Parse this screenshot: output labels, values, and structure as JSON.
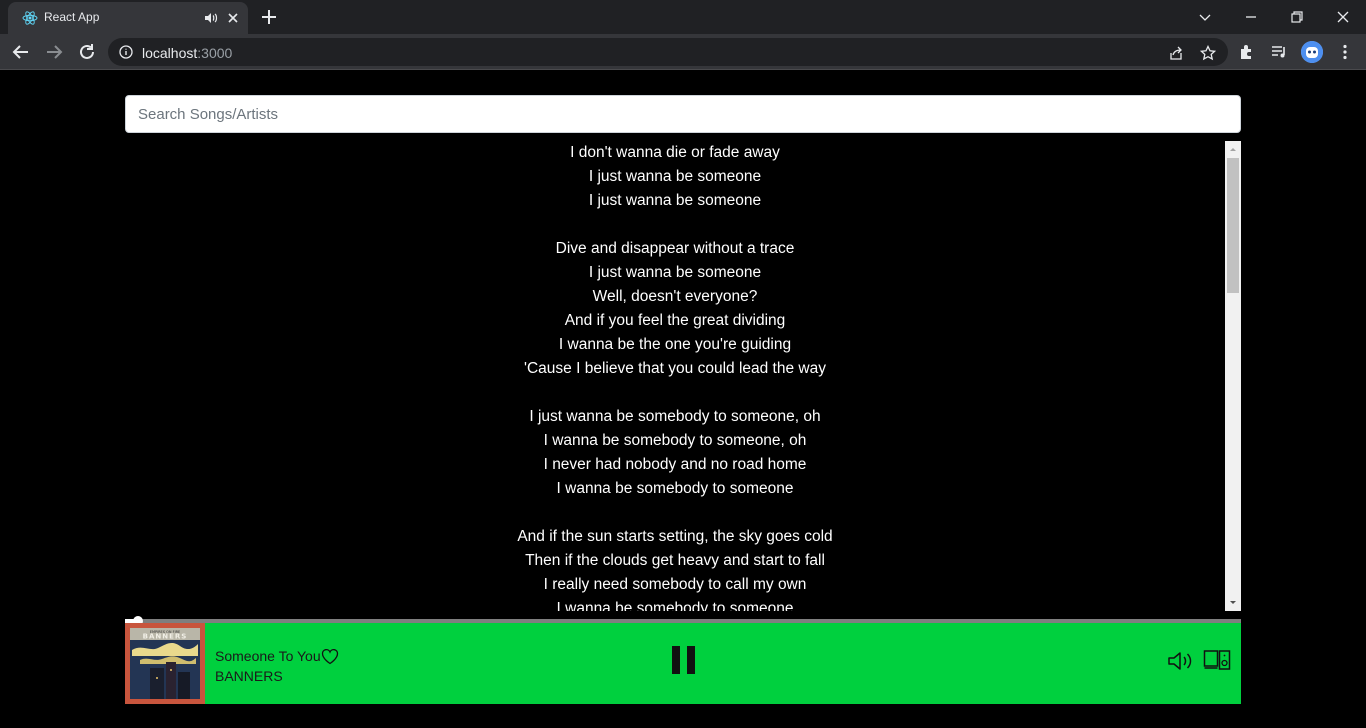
{
  "browser": {
    "tab_title": "React App",
    "url_host": "localhost",
    "url_port": ":3000"
  },
  "search": {
    "placeholder": "Search Songs/Artists",
    "value": ""
  },
  "lyrics": [
    "I don't wanna die or fade away",
    "I just wanna be someone",
    "I just wanna be someone",
    "",
    "Dive and disappear without a trace",
    "I just wanna be someone",
    "Well, doesn't everyone?",
    "And if you feel the great dividing",
    "I wanna be the one you're guiding",
    "'Cause I believe that you could lead the way",
    "",
    "I just wanna be somebody to someone, oh",
    "I wanna be somebody to someone, oh",
    "I never had nobody and no road home",
    "I wanna be somebody to someone",
    "",
    "And if the sun starts setting, the sky goes cold",
    "Then if the clouds get heavy and start to fall",
    "I really need somebody to call my own",
    "I wanna be somebody to someone"
  ],
  "player": {
    "track_title": "Someone To You",
    "artist": "BANNERS",
    "album_art_text": "BANNERS",
    "album_art_subtext": "EMPIRES ON FIRE",
    "progress_fraction": 0.008,
    "is_playing": true,
    "colors": {
      "bar": "#00d03e",
      "art_border": "#c8553d"
    }
  },
  "icons": {
    "tab_favicon": "react-logo-icon",
    "tab_audio": "speaker-icon",
    "pause": "pause-icon",
    "heart": "heart-outline-icon",
    "volume": "volume-icon",
    "devices": "devices-icon"
  }
}
